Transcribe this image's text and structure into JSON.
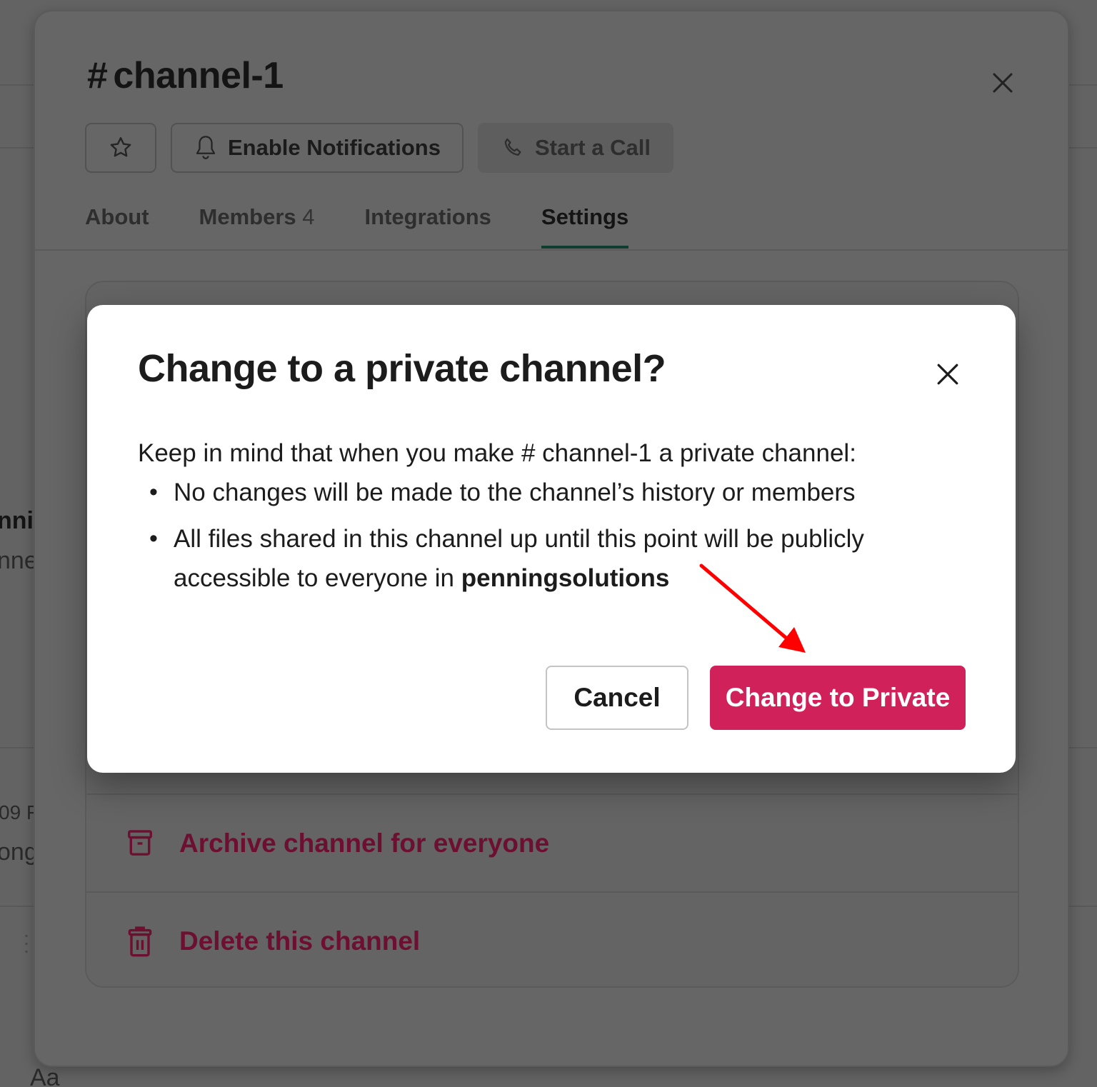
{
  "background": {
    "fragments": {
      "name_partial": "nni",
      "channel_partial": "nne",
      "time_partial": "09 F",
      "text_partial": "ong",
      "composer_partial": "Aa"
    }
  },
  "panel": {
    "title_prefix": "#",
    "title": "channel-1",
    "close_icon": "close-icon",
    "buttons": {
      "star_icon": "star-icon",
      "notifications_label": "Enable Notifications",
      "notifications_icon": "bell-icon",
      "call_label": "Start a Call",
      "call_icon": "phone-icon"
    },
    "tabs": [
      {
        "label": "About",
        "count": null,
        "active": false
      },
      {
        "label": "Members",
        "count": "4",
        "active": false
      },
      {
        "label": "Integrations",
        "count": null,
        "active": false
      },
      {
        "label": "Settings",
        "count": null,
        "active": true
      }
    ],
    "settings_rows": [
      {
        "label": "Archive channel for everyone",
        "icon": "archive-icon"
      },
      {
        "label": "Delete this channel",
        "icon": "trash-icon"
      }
    ],
    "danger_color": "#6d0f30",
    "active_tab_color": "#0f3d2f"
  },
  "modal": {
    "title": "Change to a private channel?",
    "close_icon": "close-icon",
    "intro_before": "Keep in mind that when you make ",
    "intro_channel": "# channel-1",
    "intro_after": " a private channel:",
    "bullets": [
      {
        "text": "No changes will be made to the channel’s history or members"
      },
      {
        "text": "All files shared in this channel up until this point will be publicly accessible to everyone in ",
        "bold": "penningsolutions"
      }
    ],
    "cancel_label": "Cancel",
    "confirm_label": "Change to Private",
    "confirm_color": "#d0215a"
  },
  "annotation": {
    "arrow_color": "#ff0000",
    "target": "Change to Private"
  }
}
